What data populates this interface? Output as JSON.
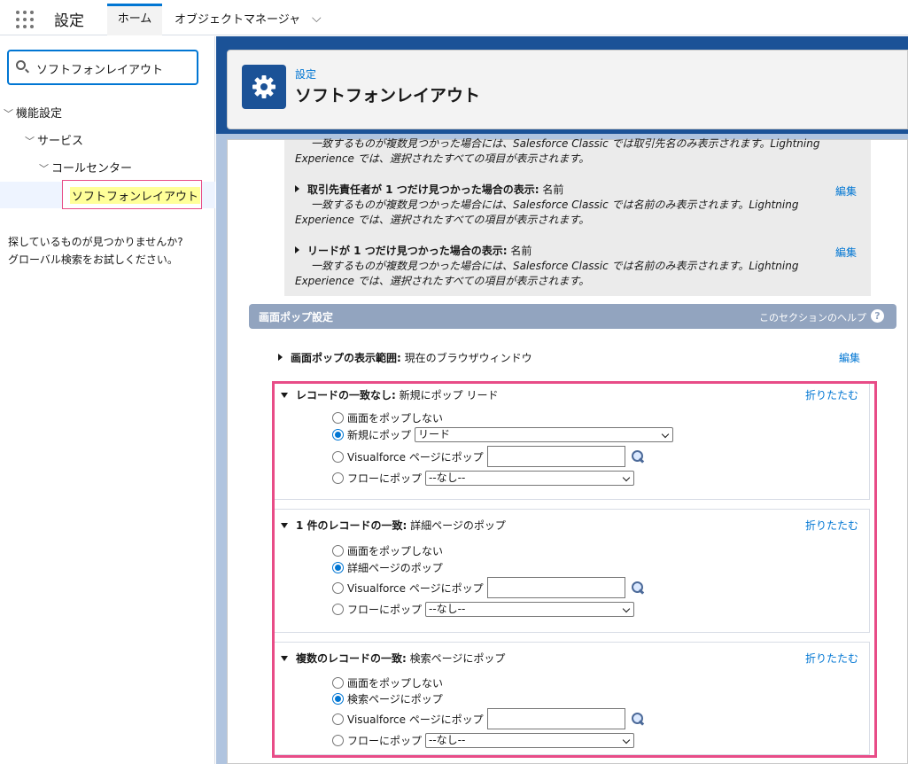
{
  "topbar": {
    "app_name": "設定",
    "tab_home": "ホーム",
    "tab_object_manager": "オブジェクトマネージャ",
    "chevron": "⌵"
  },
  "sidebar": {
    "search_value": "ソフトフォンレイアウト",
    "tree": [
      {
        "label": "機能設定"
      },
      {
        "label": "サービス"
      },
      {
        "label": "コールセンター"
      },
      {
        "label": "ソフトフォンレイアウト"
      }
    ],
    "not_found_line1": "探しているものが見つかりませんか?",
    "not_found_line2": "グローバル検索をお試しください。"
  },
  "header": {
    "breadcrumb": "設定",
    "title": "ソフトフォンレイアウト"
  },
  "upper_section": {
    "line1": "一致するものが複数見つかった場合には、Salesforce Classic では取引先名のみ表示されます。Lightning",
    "line2": "Experience では、選択されたすべての項目が表示されます。",
    "item_contact_label": "取引先責任者が 1 つだけ見つかった場合の表示:",
    "item_contact_value": "名前",
    "item_contact_desc1": "一致するものが複数見つかった場合には、Salesforce Classic では名前のみ表示されます。Lightning",
    "item_contact_desc2": "Experience では、選択されたすべての項目が表示されます。",
    "item_lead_label": "リードが 1 つだけ見つかった場合の表示:",
    "item_lead_value": "名前",
    "item_lead_desc1": "一致するものが複数見つかった場合には、Salesforce Classic では名前のみ表示されます。Lightning",
    "item_lead_desc2": "Experience では、選択されたすべての項目が表示されます。",
    "edit": "編集"
  },
  "screen_pop": {
    "section_title": "画面ポップ設定",
    "section_help": "このセクションのヘルプ",
    "range_label": "画面ポップの表示範囲:",
    "range_value": "現在のブラウザウィンドウ",
    "edit": "編集",
    "collapse": "折りたたむ",
    "panels": [
      {
        "title_bold": "レコードの一致なし:",
        "title_value": "新規にポップ リード",
        "opt_none": "画面をポップしない",
        "opt_main": "新規にポップ",
        "opt_main_select": "リード",
        "opt_vf": "Visualforce ページにポップ",
        "opt_flow": "フローにポップ",
        "opt_flow_select": "--なし--"
      },
      {
        "title_bold": "1 件のレコードの一致:",
        "title_value": "詳細ページのポップ",
        "opt_none": "画面をポップしない",
        "opt_main": "詳細ページのポップ",
        "opt_vf": "Visualforce ページにポップ",
        "opt_flow": "フローにポップ",
        "opt_flow_select": "--なし--"
      },
      {
        "title_bold": "複数のレコードの一致:",
        "title_value": "検索ページにポップ",
        "opt_none": "画面をポップしない",
        "opt_main": "検索ページにポップ",
        "opt_vf": "Visualforce ページにポップ",
        "opt_flow": "フローにポップ",
        "opt_flow_select": "--なし--"
      }
    ]
  },
  "colors": {
    "brand": "#0176d3",
    "banner": "#1b5297",
    "highlight": "#e84c87"
  }
}
